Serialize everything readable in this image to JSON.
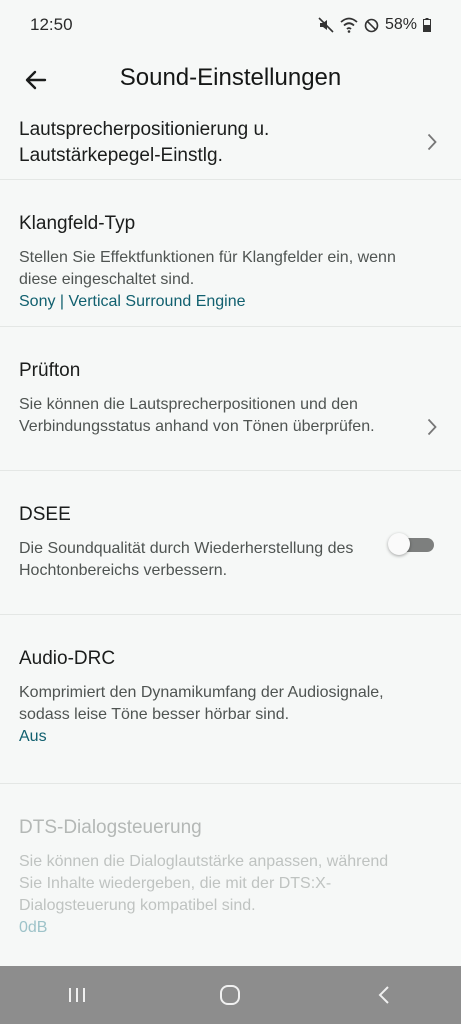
{
  "status": {
    "time": "12:50",
    "battery": "58%",
    "icons": [
      "mute-icon",
      "wifi-icon",
      "do-not-disturb-icon",
      "battery-icon"
    ]
  },
  "header": {
    "title": "Sound-Einstellungen",
    "back_icon": "arrow-left-icon"
  },
  "settings": [
    {
      "title": "Lautsprecherpositionierung u. Lautstärkepegel-Einstlg."
    },
    {
      "title": "Klangfeld-Typ",
      "description": "Stellen Sie Effektfunktionen für Klangfelder ein, wenn diese eingeschaltet sind.",
      "value": "Sony | Vertical Surround Engine"
    },
    {
      "title": "Prüfton",
      "description": "Sie können die Lautsprecherpositionen und den Verbindungsstatus anhand von Tönen überprüfen."
    },
    {
      "title": "DSEE",
      "description": "Die Soundqualität durch Wiederherstellung des Hochtonbereichs verbessern.",
      "toggle_on": false
    },
    {
      "title": "Audio-DRC",
      "description": "Komprimiert den Dynamikumfang der Audiosignale, sodass leise Töne besser hörbar sind.",
      "value": "Aus"
    },
    {
      "title": "DTS-Dialogsteuerung",
      "description": "Sie können die Dialoglautstärke anpassen, während Sie Inhalte wiedergeben, die mit der DTS:X-Dialogsteuerung kompatibel sind.",
      "value": "0dB",
      "disabled": true
    }
  ],
  "colors": {
    "background": "#f6f8f7",
    "accent": "#11606f",
    "navbar": "#8d8d8d"
  }
}
